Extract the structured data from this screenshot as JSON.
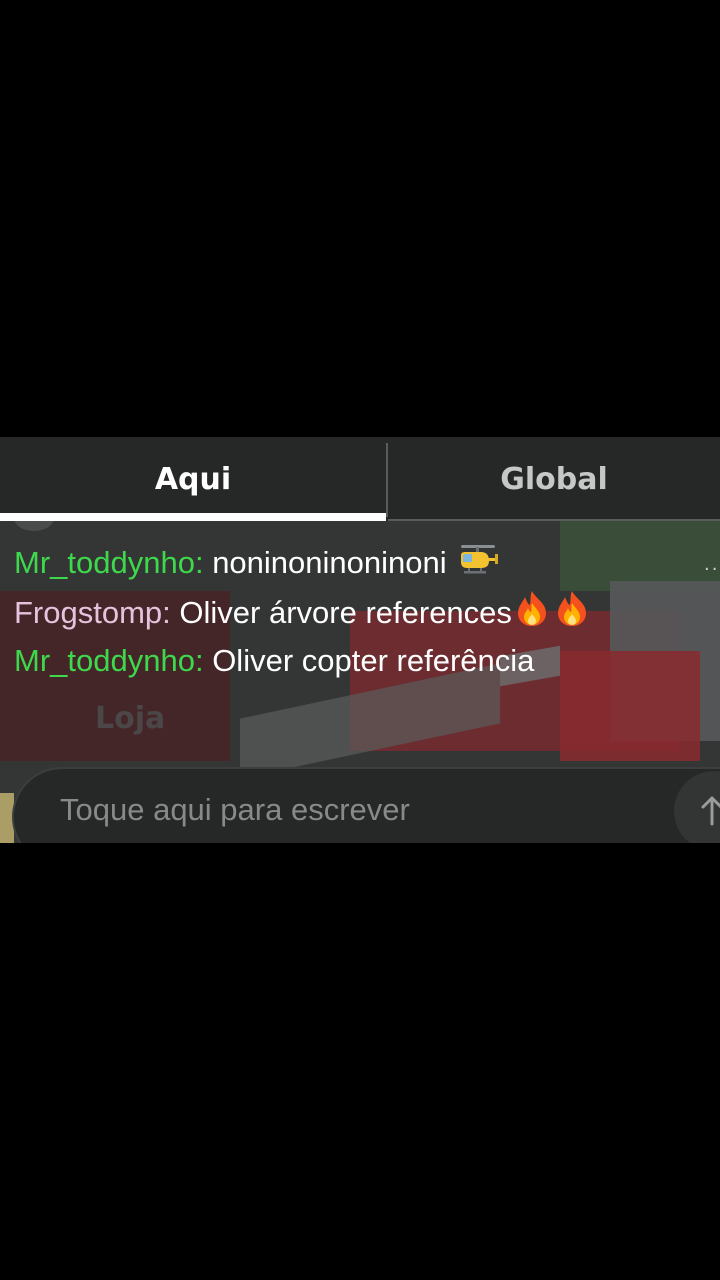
{
  "chat": {
    "tabs": [
      {
        "label": "Aqui",
        "active": true
      },
      {
        "label": "Global",
        "active": false
      }
    ],
    "background_sign": "Loja",
    "messages": [
      {
        "author": "Mr_toddynho:",
        "text": "noninoninoninoni",
        "author_color": "#3ed84c",
        "emoji": "helicopter-emoji"
      },
      {
        "author": "Frogstomp:",
        "text": "Oliver árvore references",
        "author_color": "#e6c3dd",
        "emoji": "fire-emoji x2"
      },
      {
        "author": "Mr_toddynho:",
        "text": "Oliver copter referência",
        "author_color": "#3ed84c"
      }
    ],
    "input": {
      "placeholder": "Toque aqui para escrever",
      "value": ""
    },
    "send_icon": "arrow-up-icon"
  },
  "colors": {
    "background": "#000000",
    "tab_bar": "#262727",
    "username_green": "#3ed84c",
    "username_pink": "#e6c3dd"
  }
}
